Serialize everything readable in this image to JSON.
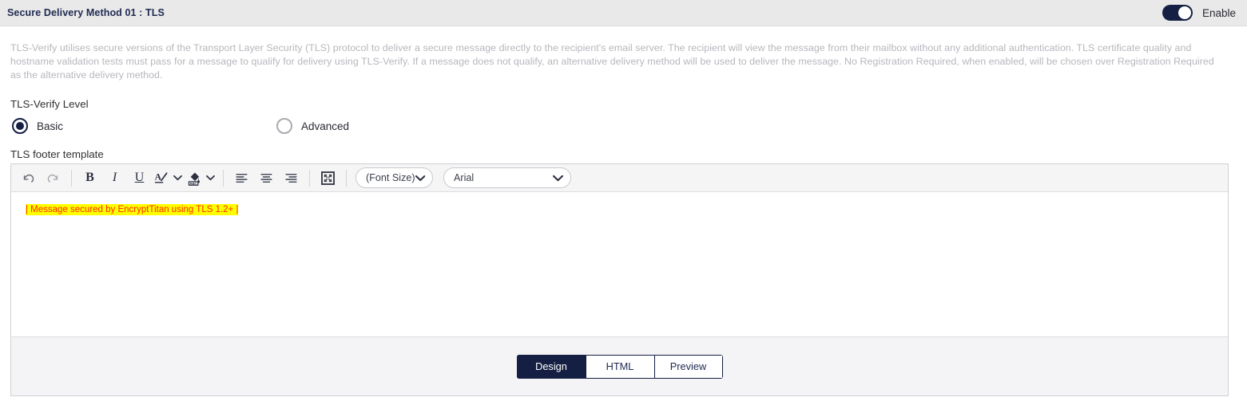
{
  "header": {
    "title": "Secure Delivery Method 01 : TLS",
    "toggle_label": "Enable",
    "toggle_state": "on",
    "accent_color": "#141f43"
  },
  "description": "TLS-Verify utilises secure versions of the Transport Layer Security (TLS) protocol to deliver a secure message directly to the recipient's email server. The recipient will view the message from their mailbox without any additional authentication. TLS certificate quality and hostname validation tests must pass for a message to qualify for delivery using TLS-Verify. If a message does not qualify, an alternative delivery method will be used to deliver the message. No Registration Required, when enabled, will be chosen over Registration Required as the alternative delivery method.",
  "tls_level": {
    "label": "TLS-Verify Level",
    "options": [
      {
        "label": "Basic",
        "selected": true
      },
      {
        "label": "Advanced",
        "selected": false
      }
    ]
  },
  "footer_template": {
    "label": "TLS footer template",
    "toolbar": {
      "undo": "Undo",
      "redo": "Redo",
      "bold": "B",
      "italic": "I",
      "underline": "U",
      "font_color": "Font Color",
      "highlight_color": "Highlight Color",
      "align_left": "Align Left",
      "align_center": "Align Center",
      "align_right": "Align Right",
      "fullscreen": "Fullscreen",
      "font_size_value": "(Font Size)",
      "font_name_value": "Arial"
    },
    "content": "| Message secured by EncryptTitan using TLS 1.2+ |",
    "content_text_color": "#ff2a00",
    "content_highlight_color": "#ffff00",
    "tabs": [
      {
        "label": "Design",
        "active": true
      },
      {
        "label": "HTML",
        "active": false
      },
      {
        "label": "Preview",
        "active": false
      }
    ]
  }
}
